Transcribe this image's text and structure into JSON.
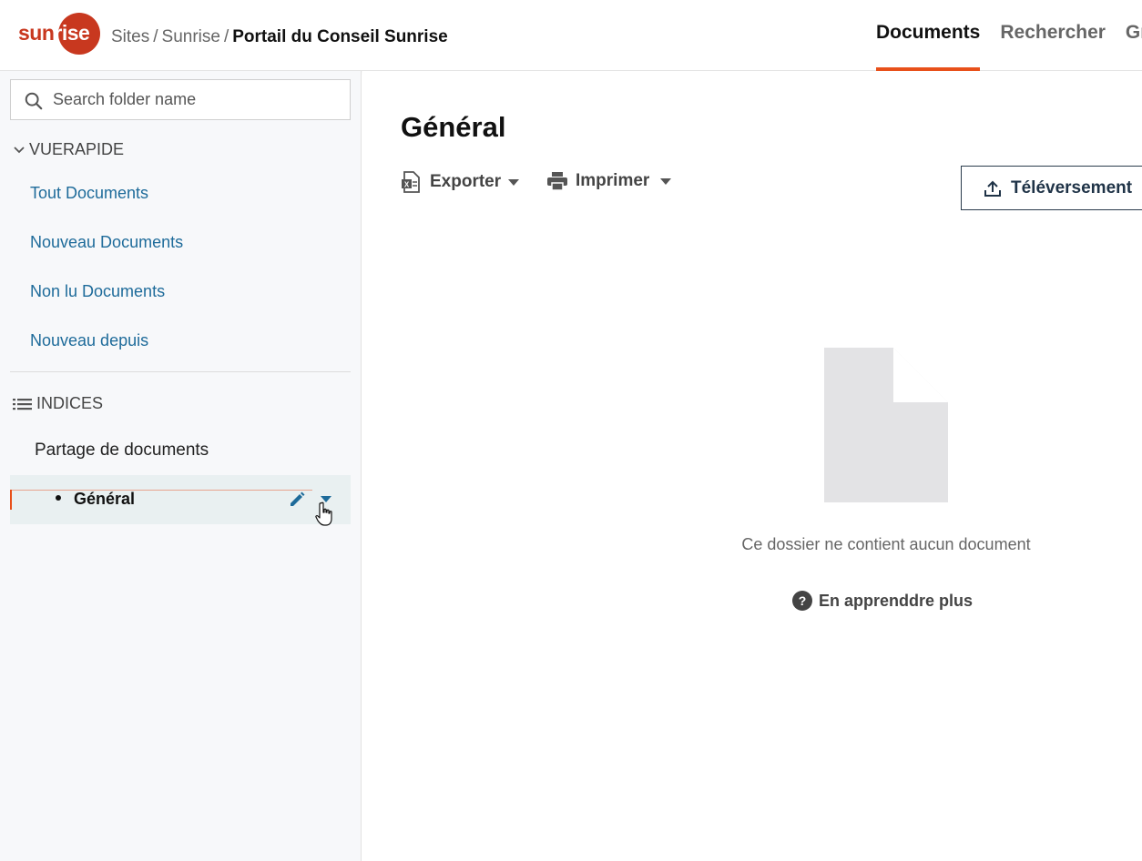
{
  "header": {
    "logo": {
      "part1": "sun",
      "part2": "rise"
    },
    "breadcrumb": {
      "item1": "Sites",
      "item2": "Sunrise",
      "current": "Portail du Conseil Sunrise",
      "separator": "/"
    },
    "tabs": [
      {
        "label": "Documents",
        "active": true
      },
      {
        "label": "Rechercher",
        "active": false
      },
      {
        "label": "Gr",
        "active": false
      }
    ]
  },
  "sidebar": {
    "search": {
      "placeholder": "Search folder name",
      "value": ""
    },
    "quick_view": {
      "heading": "VUERAPIDE",
      "links": [
        "Tout Documents",
        "Nouveau Documents",
        "Non lu Documents",
        "Nouveau depuis"
      ]
    },
    "indices": {
      "heading": "INDICES",
      "items": [
        "Partage de documents"
      ],
      "selected_folder": "Général"
    }
  },
  "main": {
    "title": "Général",
    "toolbar": {
      "export_label": "Exporter",
      "print_label": "Imprimer",
      "upload_label": "Téléversement"
    },
    "empty_state": {
      "message": "Ce dossier ne contient aucun document",
      "help_link": "En apprenddre plus"
    }
  },
  "colors": {
    "accent": "#e8501a",
    "brand": "#c8381f",
    "link": "#1e6b9a",
    "selected_bg": "#e9f0f1"
  }
}
